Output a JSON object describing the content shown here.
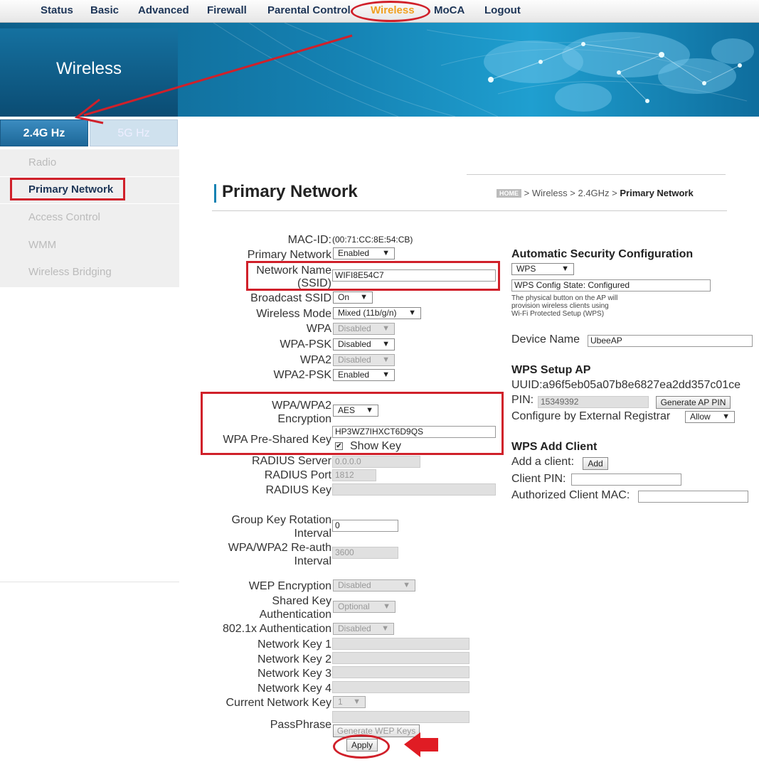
{
  "nav": {
    "items": [
      "Status",
      "Basic",
      "Advanced",
      "Firewall",
      "Parental Control",
      "Wireless",
      "MoCA",
      "Logout"
    ],
    "active": "Wireless"
  },
  "banner": {
    "title": "Wireless"
  },
  "band_tabs": {
    "tab_24": "2.4G Hz",
    "tab_5": "5G Hz"
  },
  "sidebar": {
    "items": [
      "Radio",
      "Primary Network",
      "Access Control",
      "WMM",
      "Wireless Bridging"
    ],
    "active": "Primary Network"
  },
  "page": {
    "title": "Primary Network",
    "breadcrumb": {
      "home": "HOME",
      "path": "> Wireless > 2.4GHz >",
      "current": "Primary Network"
    }
  },
  "form": {
    "mac_label": "MAC-ID:",
    "mac_value": "(00:71:CC:8E:54:CB)",
    "primary_network_label": "Primary Network",
    "primary_network_value": "Enabled",
    "ssid_label_1": "Network Name",
    "ssid_label_2": "(SSID)",
    "ssid_value": "WIFI8E54C7",
    "broadcast_label": "Broadcast SSID",
    "broadcast_value": "On",
    "mode_label": "Wireless Mode",
    "mode_value": "Mixed (11b/g/n)",
    "wpa_label": "WPA",
    "wpa_value": "Disabled",
    "wpapsk_label": "WPA-PSK",
    "wpapsk_value": "Disabled",
    "wpa2_label": "WPA2",
    "wpa2_value": "Disabled",
    "wpa2psk_label": "WPA2-PSK",
    "wpa2psk_value": "Enabled",
    "enc_label_1": "WPA/WPA2",
    "enc_label_2": "Encryption",
    "enc_value": "AES",
    "psk_label": "WPA Pre-Shared Key",
    "psk_value": "HP3WZ7IHXCT6D9QS",
    "show_key_label": "Show Key",
    "radius_server_label": "RADIUS Server",
    "radius_server_value": "0.0.0.0",
    "radius_port_label": "RADIUS Port",
    "radius_port_value": "1812",
    "radius_key_label": "RADIUS Key",
    "radius_key_value": "",
    "gkr_label_1": "Group Key Rotation",
    "gkr_label_2": "Interval",
    "gkr_value": "0",
    "reauth_label_1": "WPA/WPA2 Re-auth",
    "reauth_label_2": "Interval",
    "reauth_value": "3600",
    "wep_label": "WEP Encryption",
    "wep_value": "Disabled",
    "sk_label_1": "Shared Key",
    "sk_label_2": "Authentication",
    "sk_value": "Optional",
    "dot1x_label": "802.1x Authentication",
    "dot1x_value": "Disabled",
    "nk1_label": "Network Key 1",
    "nk2_label": "Network Key 2",
    "nk3_label": "Network Key 3",
    "nk4_label": "Network Key 4",
    "current_key_label": "Current Network Key",
    "current_key_value": "1",
    "passphrase_label": "PassPhrase",
    "gen_wep_label": "Generate WEP Keys",
    "apply_label": "Apply"
  },
  "asc": {
    "title": "Automatic Security Configuration",
    "mode_value": "WPS",
    "state_value": "WPS Config State: Configured",
    "note_1": "The physical button on the AP will",
    "note_2": "provision wireless clients using",
    "note_3": "Wi-Fi Protected Setup (WPS)",
    "device_name_label": "Device Name",
    "device_name_value": "UbeeAP"
  },
  "wps_setup": {
    "title": "WPS Setup AP",
    "uuid": "UUID:a96f5eb05a07b8e6827ea2dd357c01ce",
    "pin_label": "PIN:",
    "pin_value": "15349392",
    "gen_pin_label": "Generate AP PIN",
    "registrar_label": "Configure by External Registrar",
    "registrar_value": "Allow"
  },
  "wps_add": {
    "title": "WPS Add Client",
    "add_label": "Add a client:",
    "add_button": "Add",
    "client_pin_label": "Client PIN:",
    "client_mac_label": "Authorized Client MAC:"
  },
  "colors": {
    "annotation": "#d0202a",
    "nav_active": "#f0a020",
    "brand_blue": "#1582b3"
  }
}
